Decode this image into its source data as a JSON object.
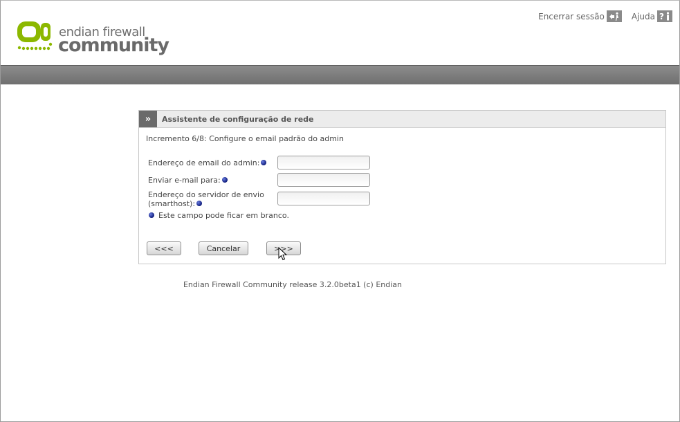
{
  "header": {
    "logo": {
      "line1": "endian firewall",
      "line2": "community"
    },
    "links": {
      "logout": "Encerrar sessão",
      "help": "Ajuda",
      "help_icon_glyph": "?"
    }
  },
  "wizard": {
    "toggle_glyph": "»",
    "title": "Assistente de configuração de rede",
    "step": "Incremento 6/8: Configure o email padrão do admin",
    "fields": [
      {
        "label": "Endereço de email do admin:",
        "value": "",
        "optional": true
      },
      {
        "label": "Enviar e-mail para:",
        "value": "",
        "optional": true
      },
      {
        "label": "Endereço do servidor de envio (smarthost):",
        "value": "",
        "optional": true
      }
    ],
    "note": "Este campo pode ficar em branco.",
    "buttons": {
      "back": "<<<",
      "cancel": "Cancelar",
      "next": ">>>"
    }
  },
  "footer": {
    "text": "Endian Firewall Community release 3.2.0beta1 (c) Endian"
  },
  "colors": {
    "brand_green": "#8cb800",
    "navbar": "#7c7c7c",
    "optional_dot": "#1a2a9a"
  }
}
